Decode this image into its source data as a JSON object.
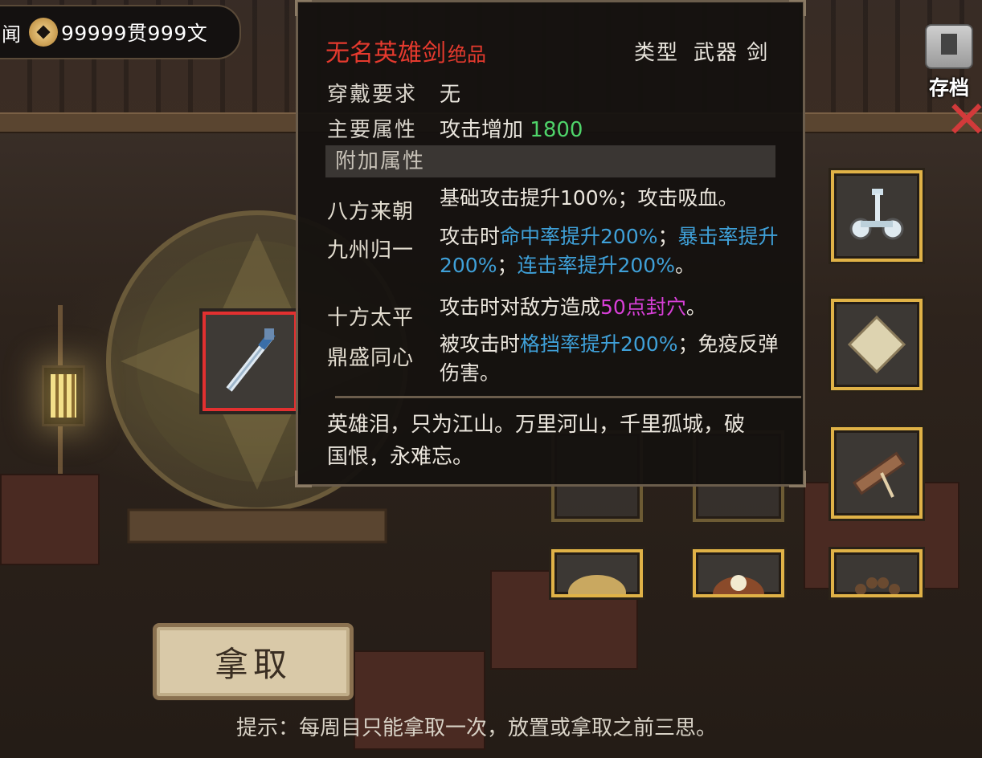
{
  "header": {
    "prev_text": "闻",
    "currency_amount": "99999贯999文",
    "save_label": "存档"
  },
  "tooltip": {
    "name": "无名英雄剑",
    "quality": "绝品",
    "type_label": "类型",
    "type_value": "武器 剑",
    "requirement_label": "穿戴要求",
    "requirement_value": "无",
    "main_attr_label": "主要属性",
    "main_attr_text": "攻击增加",
    "main_attr_value": "1800",
    "extra_attr_title": "附加属性",
    "affixes": [
      {
        "name": "八方来朝"
      },
      {
        "name": "九州归一"
      },
      {
        "name": "十方太平"
      },
      {
        "name": "鼎盛同心"
      }
    ],
    "desc1": "基础攻击提升100%；攻击吸血。",
    "desc2_a": "攻击时",
    "desc2_b": "命中率提升200%",
    "desc2_c": "；",
    "desc2_d": "暴击率提升200%",
    "desc2_e": "；",
    "desc2_f": "连击率提升200%",
    "desc2_g": "。",
    "desc3_a": "攻击时对敌方造成",
    "desc3_b": "50点封穴",
    "desc3_c": "。",
    "desc4_a": "被攻击时",
    "desc4_b": "格挡率提升200%",
    "desc4_c": "；免疫反弹伤害。",
    "flavor": "英雄泪，只为江山。万里河山，千里孤城，破国恨，永难忘。"
  },
  "actions": {
    "take_label": "拿取",
    "hint": "提示：每周目只能拿取一次，放置或拿取之前三思。"
  },
  "colors": {
    "legendary": "#e53a2e",
    "value_green": "#4fd46a",
    "stat_blue": "#3fa0d8",
    "seal_magenta": "#d83fd8",
    "slot_gold": "#e0b247",
    "selected_red": "#e23030"
  },
  "icons": {
    "currency": "coin-icon",
    "save": "save-icon",
    "close": "close-icon",
    "weapon": "sword-icon",
    "slots": [
      "segway-icon",
      "map-scroll-icon",
      "wooden-tool-icon",
      "woven-hat-icon",
      "pearl-icon",
      "bead-bracelet-icon"
    ]
  }
}
